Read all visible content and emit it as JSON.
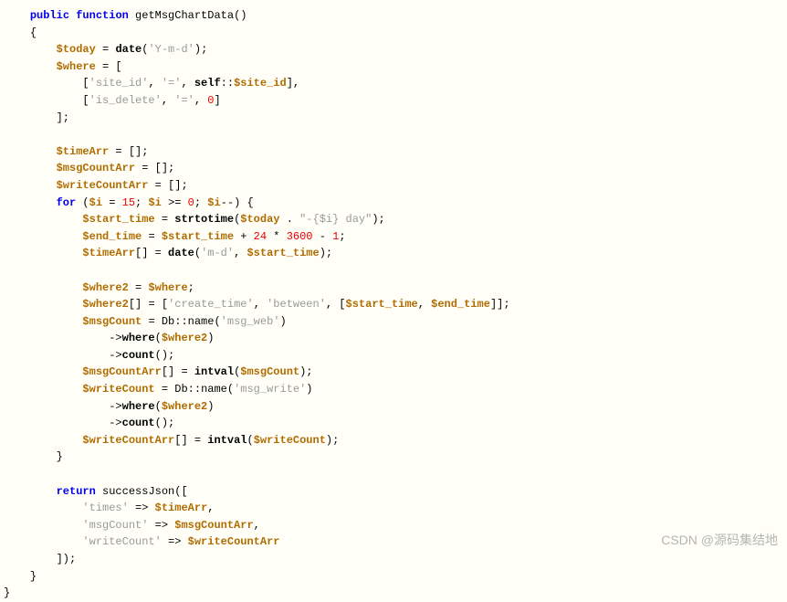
{
  "code": {
    "func_decl": {
      "public": "public",
      "function": "function",
      "name": "getMsgChartData"
    },
    "today_assign": {
      "var": "$today",
      "fn": "date",
      "arg": "'Y-m-d'"
    },
    "where_assign": {
      "var": "$where"
    },
    "where_row1": {
      "k": "'site_id'",
      "op": "'='",
      "self": "self",
      "prop": "$site_id"
    },
    "where_row2": {
      "k": "'is_delete'",
      "op": "'='",
      "val": "0"
    },
    "timeArr": "$timeArr",
    "msgCountArr": "$msgCountArr",
    "writeCountArr": "$writeCountArr",
    "for": {
      "kw": "for",
      "i": "$i",
      "init": "15",
      "cond": "0"
    },
    "start_time": {
      "var": "$start_time",
      "fn": "strtotime",
      "t": "$today",
      "suffix1": "\"-",
      "suffix_i": "{$i}",
      "suffix2": " day\""
    },
    "end_time": {
      "var": "$end_time",
      "src": "$start_time",
      "n24": "24",
      "n3600": "3600",
      "n1": "1"
    },
    "timeArrPush": {
      "fn": "date",
      "fmt": "'m-d'",
      "src": "$start_time"
    },
    "where2": "$where2",
    "where2push": {
      "k": "'create_time'",
      "op": "'between'",
      "a": "$start_time",
      "b": "$end_time"
    },
    "msgCount": {
      "var": "$msgCount",
      "db": "Db",
      "name": "name",
      "table": "'msg_web'",
      "where": "where",
      "w2": "$where2",
      "count": "count"
    },
    "msgCountPush": {
      "fn": "intval",
      "src": "$msgCount"
    },
    "writeCount": {
      "var": "$writeCount",
      "db": "Db",
      "name": "name",
      "table": "'msg_write'",
      "where": "where",
      "w2": "$where2",
      "count": "count"
    },
    "writeCountPush": {
      "fn": "intval",
      "src": "$writeCount"
    },
    "return": {
      "kw": "return",
      "fn": "successJson"
    },
    "ret_times": {
      "k": "'times'",
      "v": "$timeArr"
    },
    "ret_msgCount": {
      "k": "'msgCount'",
      "v": "$msgCountArr"
    },
    "ret_writeCount": {
      "k": "'writeCount'",
      "v": "$writeCountArr"
    }
  },
  "watermark": "CSDN @源码集结地"
}
